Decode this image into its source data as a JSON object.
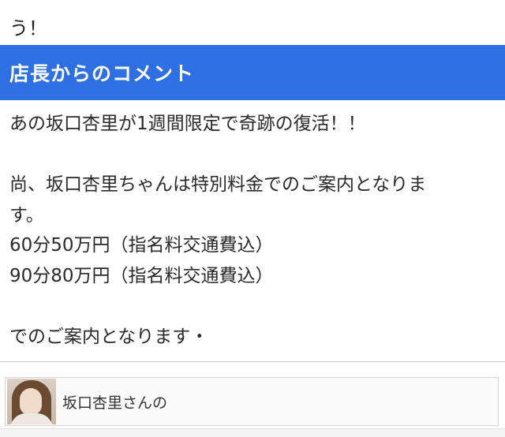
{
  "previous_section": {
    "line_tail": "う！"
  },
  "header": {
    "title": "店長からのコメント"
  },
  "comment": {
    "lines": [
      "あの坂口杏里が1週間限定で奇跡の復活！！",
      "",
      "尚、坂口杏里ちゃんは特別料金でのご案内となりま",
      "す。",
      "60分50万円（指名料交通費込）",
      "90分80万円（指名料交通費込）",
      "",
      "でのご案内となります・"
    ]
  },
  "profile_card": {
    "name_text": "坂口杏里さんの"
  },
  "colors": {
    "header_bg": "#2f6fe4",
    "header_text": "#ffffff"
  }
}
